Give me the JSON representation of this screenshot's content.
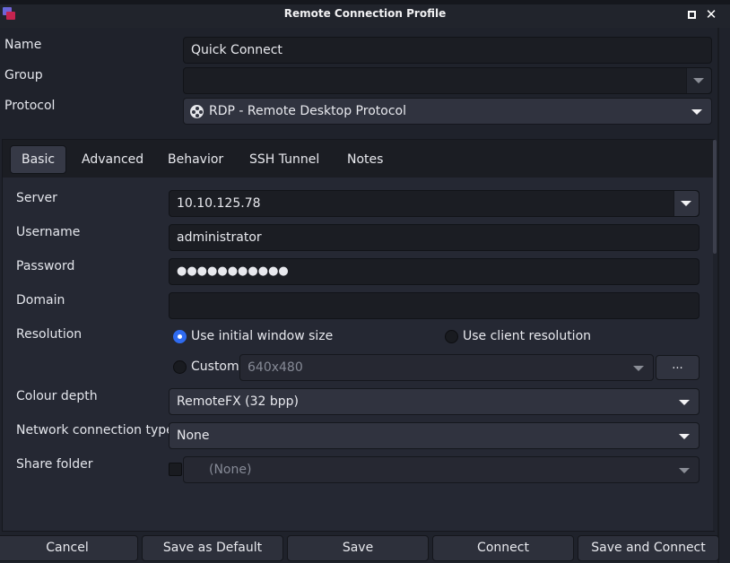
{
  "window": {
    "title": "Remote Connection Profile",
    "maximize_icon": "maximize-icon",
    "close_icon": "close-icon",
    "app_icon": "remmina-app-icon"
  },
  "profile": {
    "name_label": "Name",
    "name_value": "Quick Connect",
    "group_label": "Group",
    "group_value": "",
    "protocol_label": "Protocol",
    "protocol_value": "RDP - Remote Desktop Protocol",
    "protocol_icon": "rdp-protocol-icon"
  },
  "tabs": [
    {
      "label": "Basic",
      "active": true
    },
    {
      "label": "Advanced",
      "active": false
    },
    {
      "label": "Behavior",
      "active": false
    },
    {
      "label": "SSH Tunnel",
      "active": false
    },
    {
      "label": "Notes",
      "active": false
    }
  ],
  "basic": {
    "server_label": "Server",
    "server_value": "10.10.125.78",
    "username_label": "Username",
    "username_value": "administrator",
    "password_label": "Password",
    "password_value": "●●●●●●●●●●●",
    "domain_label": "Domain",
    "domain_value": "",
    "resolution_label": "Resolution",
    "resolution_options": [
      {
        "label": "Use initial window size",
        "selected": true
      },
      {
        "label": "Use client resolution",
        "selected": false
      },
      {
        "label": "Custom",
        "selected": false
      }
    ],
    "custom_resolution_value": "640x480",
    "custom_resolution_button": "...",
    "colour_depth_label": "Colour depth",
    "colour_depth_value": "RemoteFX (32 bpp)",
    "network_type_label": "Network connection type",
    "network_type_value": "None",
    "share_folder_label": "Share folder",
    "share_folder_checked": false,
    "share_folder_value": "(None)"
  },
  "buttons": {
    "cancel": "Cancel",
    "save_default": "Save as Default",
    "save": "Save",
    "connect": "Connect",
    "save_connect": "Save and Connect"
  },
  "colors": {
    "accent": "#2f6bf0",
    "background": "#1f222b"
  }
}
